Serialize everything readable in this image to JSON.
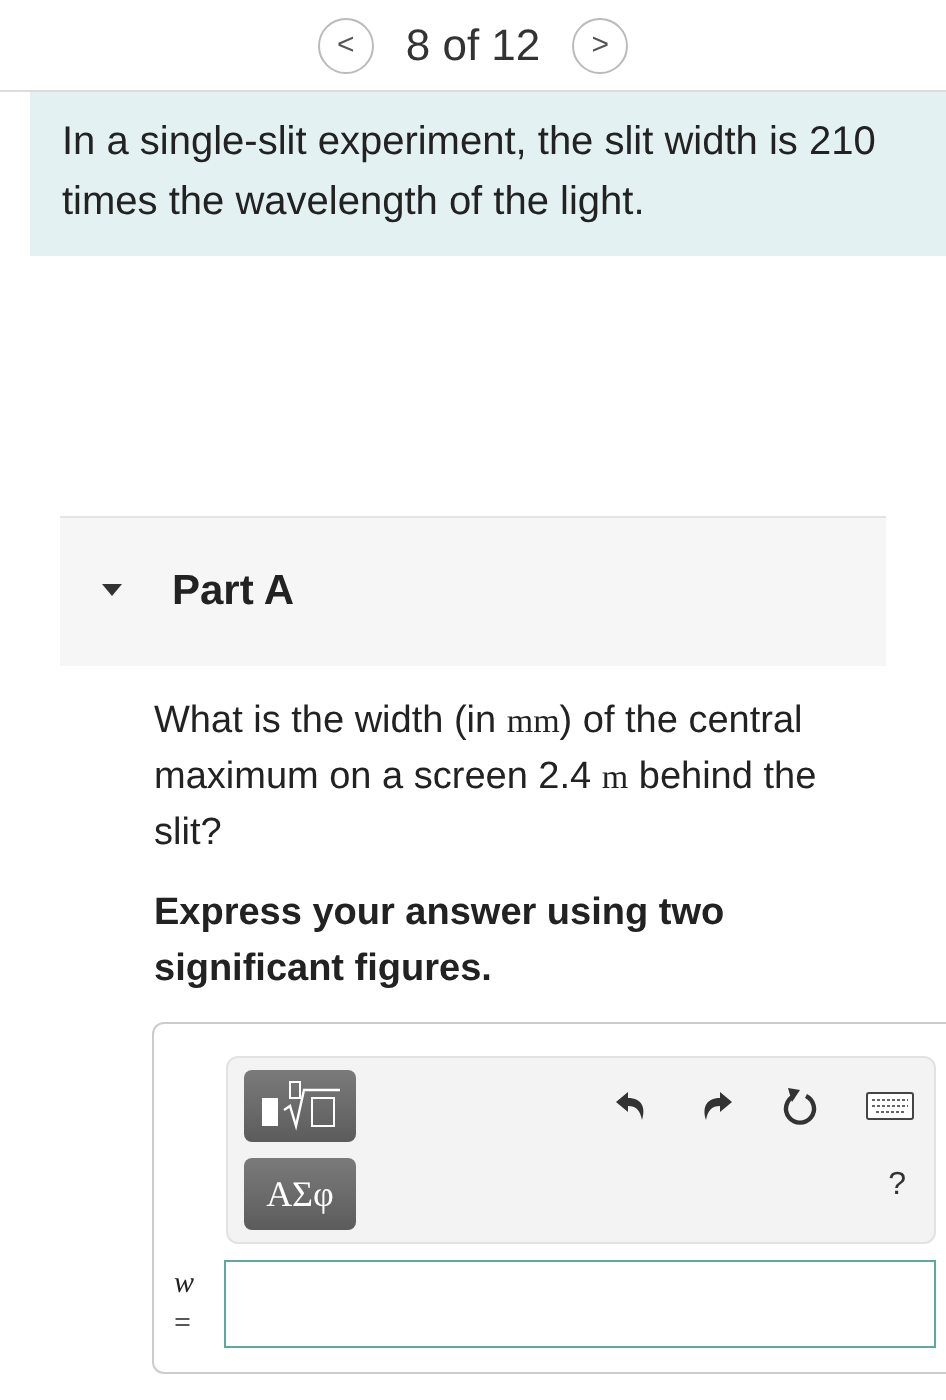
{
  "pager": {
    "prev": "<",
    "position": "8 of 12",
    "next": ">"
  },
  "intro": "In a single-slit experiment, the slit width is 210 times the wavelength of the light.",
  "part": {
    "title": "Part A",
    "expanded": true,
    "question": [
      {
        "kind": "text",
        "text": "What is the width (in "
      },
      {
        "kind": "math",
        "text": "mm"
      },
      {
        "kind": "text",
        "text": ") of the central maximum on a screen 2.4 "
      },
      {
        "kind": "math",
        "text": "m"
      },
      {
        "kind": "text",
        "text": " behind the slit?"
      }
    ],
    "instruction": "Express your answer using two significant figures.",
    "toolbar": {
      "symbols_button": "ΑΣφ",
      "help": "?"
    },
    "answer": {
      "label": "*w* ="
    }
  }
}
